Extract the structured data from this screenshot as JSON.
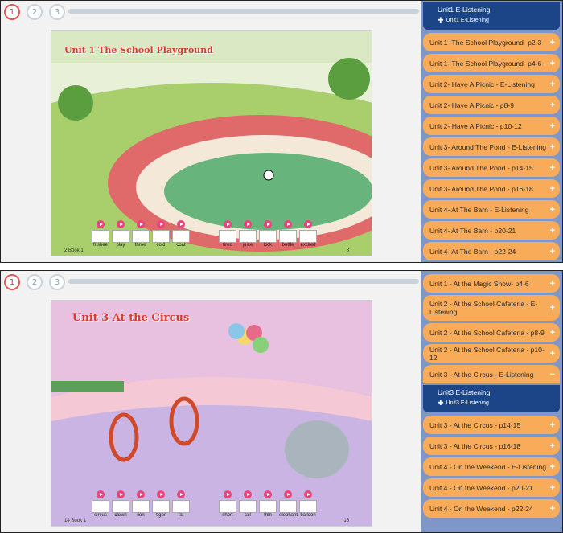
{
  "top": {
    "steps": [
      "1",
      "2",
      "3"
    ],
    "title": "Unit 1  The School Playground",
    "vocab": [
      "frisbee",
      "play",
      "throw",
      "cold",
      "coat",
      "tired",
      "juice",
      "kick",
      "bottle",
      "excited"
    ],
    "page_left": "2",
    "page_right": "3",
    "book_label": "Book 1",
    "expanded": {
      "title": "Unit1 E-Listening",
      "sub": "Unit1 E-Listening"
    },
    "items": [
      "Unit 1- The School Playground- p2-3",
      "Unit 1- The School Playground- p4-6",
      "Unit 2- Have A Picnic - E-Listening",
      "Unit 2- Have A Picnic - p8-9",
      "Unit 2- Have A Picnic - p10-12",
      "Unit 3- Around The Pond - E-Listening",
      "Unit 3- Around The Pond - p14-15",
      "Unit 3- Around The Pond - p16-18",
      "Unit 4- At The Barn - E-Listening",
      "Unit 4- At The Barn - p20-21",
      "Unit 4- At The Barn - p22-24"
    ]
  },
  "bottom": {
    "steps": [
      "1",
      "2",
      "3"
    ],
    "title": "Unit 3  At the Circus",
    "vocab": [
      "circus",
      "clown",
      "lion",
      "tiger",
      "fat",
      "short",
      "tall",
      "thin",
      "elephant",
      "balloon"
    ],
    "page_left": "14",
    "page_right": "15",
    "book_label": "Book 1",
    "items_before": [
      "Unit 1 - At the Magic Show- p4-6",
      "Unit 2 - At the School Cafeteria - E-Listening",
      "Unit 2 - At the School Cafeteria - p8-9",
      "Unit 2 - At the School Cafeteria - p10-12",
      "Unit 3 - At the Circus - E-Listening"
    ],
    "expanded": {
      "title": "Unit3 E-Listening",
      "sub": "Unit3 E-Listening"
    },
    "items_after": [
      "Unit 3 - At the Circus - p14-15",
      "Unit 3 - At the Circus - p16-18",
      "Unit 4 - On the Weekend - E-Listening",
      "Unit 4 - On the Weekend - p20-21",
      "Unit 4 - On the Weekend - p22-24"
    ]
  }
}
